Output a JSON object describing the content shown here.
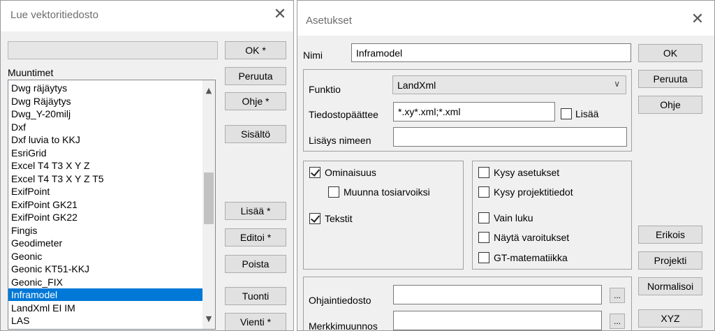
{
  "left_dialog": {
    "title": "Lue vektoritiedosto",
    "close_glyph": "✕",
    "filter_value": "",
    "list_label": "Muuntimet",
    "items": [
      "Dwg räjäytys",
      "Dwg Räjäytys",
      "Dwg_Y-20milj",
      "Dxf",
      "Dxf luvia to KKJ",
      "EsriGrid",
      "Excel T4 T3 X Y Z",
      "Excel T4 T3 X Y Z T5",
      "ExifPoint",
      "ExifPoint GK21",
      "ExifPoint GK22",
      "Fingis",
      "Geodimeter",
      "Geonic",
      "Geonic KT51-KKJ",
      "Geonic_FIX",
      "Inframodel",
      "LandXml EI IM",
      "LAS"
    ],
    "selected": "Inframodel",
    "buttons": {
      "ok": "OK *",
      "cancel": "Peruuta",
      "help": "Ohje *",
      "content": "Sisältö",
      "add": "Lisää *",
      "edit": "Editoi *",
      "remove": "Poista",
      "import": "Tuonti",
      "export": "Vienti *"
    }
  },
  "right_dialog": {
    "title": "Asetukset",
    "close_glyph": "✕",
    "name_label": "Nimi",
    "name_value": "Inframodel",
    "function_label": "Funktio",
    "function_value": "LandXml",
    "ext_label": "Tiedostopäättee",
    "ext_value": "*.xy*.xml;*.xml",
    "ext_add_label": "Lisää",
    "name_suffix_label": "Lisäys nimeen",
    "name_suffix_value": "",
    "checks_left": [
      {
        "label": "Ominaisuus",
        "checked": true
      },
      {
        "label": "Muunna tosiarvoiksi",
        "checked": false
      },
      {
        "label": "Tekstit",
        "checked": true
      }
    ],
    "checks_right": [
      {
        "label": "Kysy asetukset",
        "checked": false
      },
      {
        "label": "Kysy projektitiedot",
        "checked": false
      },
      {
        "label": "Vain luku",
        "checked": false
      },
      {
        "label": "Näytä varoitukset",
        "checked": false
      },
      {
        "label": "GT-matematiikka",
        "checked": false
      }
    ],
    "control_file_label": "Ohjaintiedosto",
    "control_file_value": "",
    "char_conv_label": "Merkkimuunnos",
    "char_conv_value": "",
    "browse_label": "...",
    "buttons": {
      "ok": "OK",
      "cancel": "Peruuta",
      "help": "Ohje",
      "special": "Erikois",
      "project": "Projekti",
      "normalize": "Normalisoi",
      "xyz": "XYZ"
    }
  }
}
